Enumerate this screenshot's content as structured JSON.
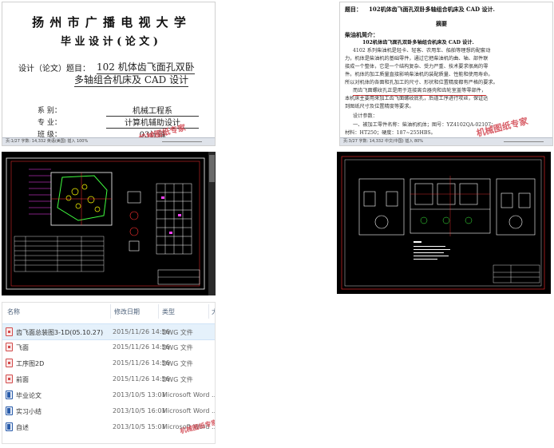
{
  "cover": {
    "university": "扬 州 市 广 播 电 视 大 学",
    "doc_type": "毕 业 设 计 ( 论 文 )",
    "topic_label": "设计（论文）题目：",
    "topic_line1": "102 机体齿飞面孔双卧",
    "topic_line2": "多轴组合机床及 CAD 设计",
    "fields": [
      {
        "label": "系     别：",
        "value": "机械工程系"
      },
      {
        "label": "专     业：",
        "value": "计算机辅助设计"
      },
      {
        "label": "班     级：",
        "value": "03计辅"
      }
    ],
    "status_bar": "页:1/27  字数: 14,332  英语(美国)  插入                    100%",
    "watermark": "机械图纸专家"
  },
  "abstract": {
    "title_prefix": "题目：",
    "title": "102机体齿飞面孔双卧多轴组合机床及 CAD 设计.",
    "heading": "摘要",
    "section": "柴油机简介：",
    "lines": [
      "102机体齿飞面孔双卧多轴组合机床及 CAD 设计.",
      "4102 系列柴油机是轻卡、轻客、农用车、船舶等理想的配套动",
      "力，机体是柴油机的基础零件，通过它把柴油机的曲、轴、部件联",
      "接成一个整体，它是一个结构复杂、受力严重、技术要求很高的零",
      "件。机体的加工质量直接影响柴油机的装配质量、性能和使用寿命。",
      "所以对机体的各面和孔加工的尺寸、形状和位置精度都有严格的要求。",
      "而齿飞面螺纹孔正是用于连接离合器壳和齿轮室盖等零部件，",
      "本机床主要用来加工齿飞面螺纹底孔，后道工序进行攻丝，保证达",
      "到图纸尺寸及位置精度等要求。",
      "设计参数：",
      "一、被加工零件名称：柴油机机体；图号：YZ4102QA-02107；",
      "材料：HT250；硬度：187~255HBS。"
    ],
    "status_bar": "页:3/27  字数: 14,332  中文(中国)  插入                    80%",
    "watermark": "机械图纸专家"
  },
  "explorer": {
    "columns": {
      "name": "名称",
      "date": "修改日期",
      "type": "类型",
      "size": "大"
    },
    "files": [
      {
        "name": "齿飞面总装图3-1D(05.10.27)",
        "date": "2015/11/26 14:56",
        "type": "DWG 文件",
        "icon": "dwg-file-icon"
      },
      {
        "name": "飞面",
        "date": "2015/11/26 14:56",
        "type": "DWG 文件",
        "icon": "dwg-file-icon"
      },
      {
        "name": "工序图2D",
        "date": "2015/11/26 14:56",
        "type": "DWG 文件",
        "icon": "dwg-file-icon"
      },
      {
        "name": "前面",
        "date": "2015/11/26 14:56",
        "type": "DWG 文件",
        "icon": "dwg-file-icon"
      },
      {
        "name": "毕业论文",
        "date": "2013/10/5 13:01",
        "type": "Microsoft Word ...",
        "icon": "word-file-icon"
      },
      {
        "name": "实习小结",
        "date": "2013/10/5 16:01",
        "type": "Microsoft Word ...",
        "icon": "word-file-icon"
      },
      {
        "name": "自述",
        "date": "2013/10/5 15:01",
        "type": "Microsoft Word ...",
        "icon": "word-file-icon"
      }
    ],
    "watermark": "机械图纸专家"
  },
  "colors": {
    "cad_background": "#000000",
    "cad_red": "#ff3030",
    "cad_white": "#ffffff",
    "cad_magenta": "#ff40ff",
    "cad_yellow": "#ffff00",
    "cad_green": "#40ff40",
    "watermark": "#d2444e",
    "explorer_header": "#4c607a"
  }
}
